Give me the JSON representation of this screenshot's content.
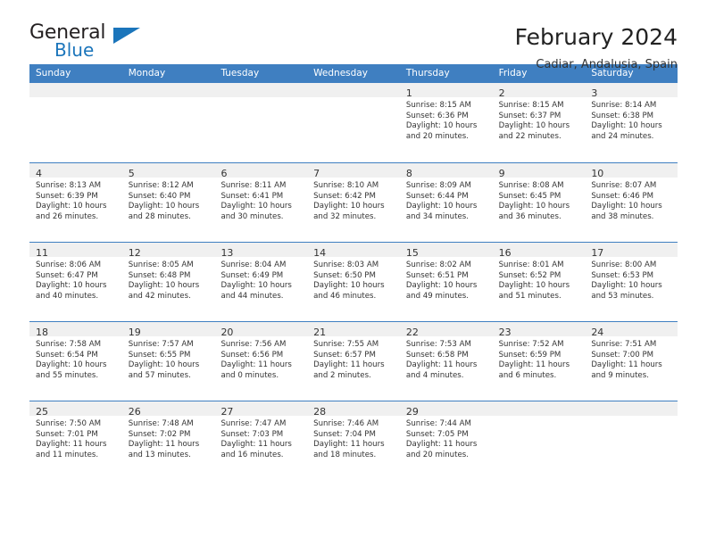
{
  "logo": {
    "word1": "General",
    "word2": "Blue",
    "accent": "#1b75bb"
  },
  "header": {
    "title": "February 2024",
    "subtitle": "Cadiar, Andalusia, Spain"
  },
  "theme": {
    "header_bg": "#3f7fc1",
    "daynum_bg": "#f0f0f0",
    "text": "#333333"
  },
  "calendar": {
    "weekdays": [
      "Sunday",
      "Monday",
      "Tuesday",
      "Wednesday",
      "Thursday",
      "Friday",
      "Saturday"
    ],
    "weeks": [
      [
        {
          "day": ""
        },
        {
          "day": ""
        },
        {
          "day": ""
        },
        {
          "day": ""
        },
        {
          "day": "1",
          "sunrise": "Sunrise: 8:15 AM",
          "sunset": "Sunset: 6:36 PM",
          "daylight1": "Daylight: 10 hours",
          "daylight2": "and 20 minutes."
        },
        {
          "day": "2",
          "sunrise": "Sunrise: 8:15 AM",
          "sunset": "Sunset: 6:37 PM",
          "daylight1": "Daylight: 10 hours",
          "daylight2": "and 22 minutes."
        },
        {
          "day": "3",
          "sunrise": "Sunrise: 8:14 AM",
          "sunset": "Sunset: 6:38 PM",
          "daylight1": "Daylight: 10 hours",
          "daylight2": "and 24 minutes."
        }
      ],
      [
        {
          "day": "4",
          "sunrise": "Sunrise: 8:13 AM",
          "sunset": "Sunset: 6:39 PM",
          "daylight1": "Daylight: 10 hours",
          "daylight2": "and 26 minutes."
        },
        {
          "day": "5",
          "sunrise": "Sunrise: 8:12 AM",
          "sunset": "Sunset: 6:40 PM",
          "daylight1": "Daylight: 10 hours",
          "daylight2": "and 28 minutes."
        },
        {
          "day": "6",
          "sunrise": "Sunrise: 8:11 AM",
          "sunset": "Sunset: 6:41 PM",
          "daylight1": "Daylight: 10 hours",
          "daylight2": "and 30 minutes."
        },
        {
          "day": "7",
          "sunrise": "Sunrise: 8:10 AM",
          "sunset": "Sunset: 6:42 PM",
          "daylight1": "Daylight: 10 hours",
          "daylight2": "and 32 minutes."
        },
        {
          "day": "8",
          "sunrise": "Sunrise: 8:09 AM",
          "sunset": "Sunset: 6:44 PM",
          "daylight1": "Daylight: 10 hours",
          "daylight2": "and 34 minutes."
        },
        {
          "day": "9",
          "sunrise": "Sunrise: 8:08 AM",
          "sunset": "Sunset: 6:45 PM",
          "daylight1": "Daylight: 10 hours",
          "daylight2": "and 36 minutes."
        },
        {
          "day": "10",
          "sunrise": "Sunrise: 8:07 AM",
          "sunset": "Sunset: 6:46 PM",
          "daylight1": "Daylight: 10 hours",
          "daylight2": "and 38 minutes."
        }
      ],
      [
        {
          "day": "11",
          "sunrise": "Sunrise: 8:06 AM",
          "sunset": "Sunset: 6:47 PM",
          "daylight1": "Daylight: 10 hours",
          "daylight2": "and 40 minutes."
        },
        {
          "day": "12",
          "sunrise": "Sunrise: 8:05 AM",
          "sunset": "Sunset: 6:48 PM",
          "daylight1": "Daylight: 10 hours",
          "daylight2": "and 42 minutes."
        },
        {
          "day": "13",
          "sunrise": "Sunrise: 8:04 AM",
          "sunset": "Sunset: 6:49 PM",
          "daylight1": "Daylight: 10 hours",
          "daylight2": "and 44 minutes."
        },
        {
          "day": "14",
          "sunrise": "Sunrise: 8:03 AM",
          "sunset": "Sunset: 6:50 PM",
          "daylight1": "Daylight: 10 hours",
          "daylight2": "and 46 minutes."
        },
        {
          "day": "15",
          "sunrise": "Sunrise: 8:02 AM",
          "sunset": "Sunset: 6:51 PM",
          "daylight1": "Daylight: 10 hours",
          "daylight2": "and 49 minutes."
        },
        {
          "day": "16",
          "sunrise": "Sunrise: 8:01 AM",
          "sunset": "Sunset: 6:52 PM",
          "daylight1": "Daylight: 10 hours",
          "daylight2": "and 51 minutes."
        },
        {
          "day": "17",
          "sunrise": "Sunrise: 8:00 AM",
          "sunset": "Sunset: 6:53 PM",
          "daylight1": "Daylight: 10 hours",
          "daylight2": "and 53 minutes."
        }
      ],
      [
        {
          "day": "18",
          "sunrise": "Sunrise: 7:58 AM",
          "sunset": "Sunset: 6:54 PM",
          "daylight1": "Daylight: 10 hours",
          "daylight2": "and 55 minutes."
        },
        {
          "day": "19",
          "sunrise": "Sunrise: 7:57 AM",
          "sunset": "Sunset: 6:55 PM",
          "daylight1": "Daylight: 10 hours",
          "daylight2": "and 57 minutes."
        },
        {
          "day": "20",
          "sunrise": "Sunrise: 7:56 AM",
          "sunset": "Sunset: 6:56 PM",
          "daylight1": "Daylight: 11 hours",
          "daylight2": "and 0 minutes."
        },
        {
          "day": "21",
          "sunrise": "Sunrise: 7:55 AM",
          "sunset": "Sunset: 6:57 PM",
          "daylight1": "Daylight: 11 hours",
          "daylight2": "and 2 minutes."
        },
        {
          "day": "22",
          "sunrise": "Sunrise: 7:53 AM",
          "sunset": "Sunset: 6:58 PM",
          "daylight1": "Daylight: 11 hours",
          "daylight2": "and 4 minutes."
        },
        {
          "day": "23",
          "sunrise": "Sunrise: 7:52 AM",
          "sunset": "Sunset: 6:59 PM",
          "daylight1": "Daylight: 11 hours",
          "daylight2": "and 6 minutes."
        },
        {
          "day": "24",
          "sunrise": "Sunrise: 7:51 AM",
          "sunset": "Sunset: 7:00 PM",
          "daylight1": "Daylight: 11 hours",
          "daylight2": "and 9 minutes."
        }
      ],
      [
        {
          "day": "25",
          "sunrise": "Sunrise: 7:50 AM",
          "sunset": "Sunset: 7:01 PM",
          "daylight1": "Daylight: 11 hours",
          "daylight2": "and 11 minutes."
        },
        {
          "day": "26",
          "sunrise": "Sunrise: 7:48 AM",
          "sunset": "Sunset: 7:02 PM",
          "daylight1": "Daylight: 11 hours",
          "daylight2": "and 13 minutes."
        },
        {
          "day": "27",
          "sunrise": "Sunrise: 7:47 AM",
          "sunset": "Sunset: 7:03 PM",
          "daylight1": "Daylight: 11 hours",
          "daylight2": "and 16 minutes."
        },
        {
          "day": "28",
          "sunrise": "Sunrise: 7:46 AM",
          "sunset": "Sunset: 7:04 PM",
          "daylight1": "Daylight: 11 hours",
          "daylight2": "and 18 minutes."
        },
        {
          "day": "29",
          "sunrise": "Sunrise: 7:44 AM",
          "sunset": "Sunset: 7:05 PM",
          "daylight1": "Daylight: 11 hours",
          "daylight2": "and 20 minutes."
        },
        {
          "day": ""
        },
        {
          "day": ""
        }
      ]
    ]
  }
}
